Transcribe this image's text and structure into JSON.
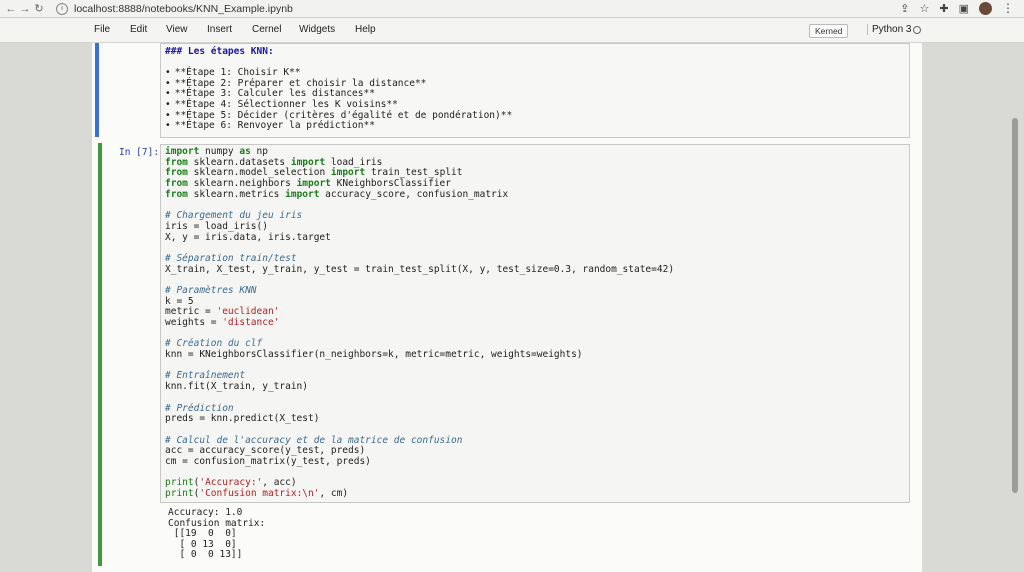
{
  "browser": {
    "url": "localhost:8888/notebooks/KNN_Example.ipynb"
  },
  "menu": {
    "items": [
      "File",
      "Edit",
      "View",
      "Insert",
      "Cernel",
      "Widgets",
      "Help"
    ],
    "kernel_badge": "Kerned",
    "kernel_name": "Python 3"
  },
  "markdown_cell": {
    "heading": "### Les étapes KNN:",
    "items": [
      "**Étape 1: Choisir K**",
      "**Étape 2: Préparer et choisir la distance**",
      "**Étape 3: Calculer les distances**",
      "**Étape 4: Sélectionner les K voisins**",
      "**Étape 5: Décider (critères d'égalité et de pondération)**",
      "**Étape 6: Renvoyer la prédiction**"
    ]
  },
  "code_cell": {
    "prompt": "In [7]:",
    "lines": [
      "import numpy as np",
      "from sklearn.datasets import load_iris",
      "from sklearn.model_selection import train_test_split",
      "from sklearn.neighbors import KNeighborsClassifier",
      "from sklearn.metrics import accuracy_score, confusion_matrix",
      "",
      "# Chargement du jeu iris",
      "iris = load_iris()",
      "X, y = iris.data, iris.target",
      "",
      "# Séparation train/test",
      "X_train, X_test, y_train, y_test = train_test_split(X, y, test_size=0.3, random_state=42)",
      "",
      "# Paramètres KNN",
      "k = 5",
      "metric = 'euclidean'",
      "weights = 'distance'",
      "",
      "# Création du clf",
      "knn = KNeighborsClassifier(n_neighbors=k, metric=metric, weights=weights)",
      "",
      "# Entraînement",
      "knn.fit(X_train, y_train)",
      "",
      "# Prédiction",
      "preds = knn.predict(X_test)",
      "",
      "# Calcul de l'accuracy et de la matrice de confusion",
      "acc = accuracy_score(y_test, preds)",
      "cm = confusion_matrix(y_test, preds)",
      "",
      "print('Accuracy:', acc)",
      "print('Confusion matrix:\\n', cm)"
    ],
    "output": [
      "Accuracy: 1.0",
      "Confusion matrix:",
      " [[19  0  0]",
      "  [ 0 13  0]",
      "  [ 0  0 13]]"
    ]
  }
}
